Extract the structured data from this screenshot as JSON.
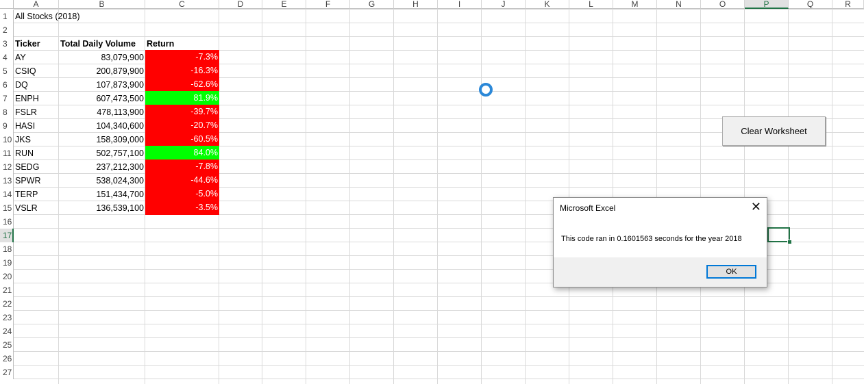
{
  "columns": [
    "A",
    "B",
    "C",
    "D",
    "E",
    "F",
    "G",
    "H",
    "I",
    "J",
    "K",
    "L",
    "M",
    "N",
    "O",
    "P",
    "Q",
    "R"
  ],
  "rows": [
    "1",
    "2",
    "3",
    "4",
    "5",
    "6",
    "7",
    "8",
    "9",
    "10",
    "11",
    "12",
    "13",
    "14",
    "15",
    "16",
    "17",
    "18",
    "19",
    "20",
    "21",
    "22",
    "23",
    "24",
    "25",
    "26",
    "27"
  ],
  "sheet": {
    "title": "All Stocks (2018)",
    "headers": {
      "ticker": "Ticker",
      "volume": "Total Daily Volume",
      "return": "Return"
    },
    "data": [
      {
        "ticker": "AY",
        "volume": "83,079,900",
        "return": "-7.3%",
        "status": "neg"
      },
      {
        "ticker": "CSIQ",
        "volume": "200,879,900",
        "return": "-16.3%",
        "status": "neg"
      },
      {
        "ticker": "DQ",
        "volume": "107,873,900",
        "return": "-62.6%",
        "status": "neg"
      },
      {
        "ticker": "ENPH",
        "volume": "607,473,500",
        "return": "81.9%",
        "status": "pos"
      },
      {
        "ticker": "FSLR",
        "volume": "478,113,900",
        "return": "-39.7%",
        "status": "neg"
      },
      {
        "ticker": "HASI",
        "volume": "104,340,600",
        "return": "-20.7%",
        "status": "neg"
      },
      {
        "ticker": "JKS",
        "volume": "158,309,000",
        "return": "-60.5%",
        "status": "neg"
      },
      {
        "ticker": "RUN",
        "volume": "502,757,100",
        "return": "84.0%",
        "status": "pos"
      },
      {
        "ticker": "SEDG",
        "volume": "237,212,300",
        "return": "-7.8%",
        "status": "neg"
      },
      {
        "ticker": "SPWR",
        "volume": "538,024,300",
        "return": "-44.6%",
        "status": "neg"
      },
      {
        "ticker": "TERP",
        "volume": "151,434,700",
        "return": "-5.0%",
        "status": "neg"
      },
      {
        "ticker": "VSLR",
        "volume": "136,539,100",
        "return": "-3.5%",
        "status": "neg"
      }
    ]
  },
  "selected": {
    "column": "P",
    "row": "17"
  },
  "clear_button": {
    "label": "Clear Worksheet"
  },
  "dialog": {
    "title": "Microsoft Excel",
    "message": "This code ran in 0.1601563 seconds for the year 2018",
    "ok_label": "OK",
    "close_glyph": "✕"
  },
  "colors": {
    "negative": "#ff0000",
    "positive": "#00ff00",
    "selection": "#217346",
    "spinner": "#2b88d8"
  }
}
